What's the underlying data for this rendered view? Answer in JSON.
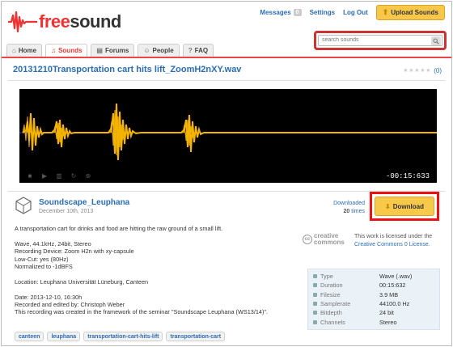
{
  "header": {
    "logo_text_free": "free",
    "logo_text_sound": "sound",
    "messages_label": "Messages",
    "messages_count": "0",
    "settings_label": "Settings",
    "logout_label": "Log Out",
    "upload_label": "Upload Sounds",
    "search_placeholder": "search sounds"
  },
  "nav": {
    "tabs": [
      {
        "label": "Home",
        "icon": "home-icon"
      },
      {
        "label": "Sounds",
        "icon": "headphones-icon",
        "active": true
      },
      {
        "label": "Forums",
        "icon": "chat-icon"
      },
      {
        "label": "People",
        "icon": "people-icon"
      },
      {
        "label": "FAQ",
        "icon": "help-icon"
      }
    ]
  },
  "sound": {
    "title": "20131210Transportation cart hits lift_ZoomH2nXY.wav",
    "rating_count": "(0)",
    "player_time": "-00:15:633",
    "username": "Soundscape_Leuphana",
    "date": "December 10th, 2013",
    "downloaded_label": "Downloaded",
    "downloaded_count": "20",
    "downloaded_suffix": "times",
    "download_label": "Download",
    "description": [
      "A transportation cart for drinks and food are hitting the raw ground of a small lift.",
      "Wave, 44.1kHz, 24bit, Stereo\nRecording Device: Zoom H2n with xy-capsule\nLow-Cut: yes (80Hz)\nNormalized to -1dBFS",
      "Location: Leuphana Universität Lüneburg, Canteen",
      "Date: 2013-12-10, 16:30h\nRecorded and edited by: Christoph Weber\nThis recording was created in the framework of the seminar \"Soundscape Leuphana (WS13/14)\"."
    ],
    "license_prefix": "This work is licensed under the ",
    "license_link": "Creative Commons 0 License",
    "license_suffix": ".",
    "cc_logo_line1": "creative",
    "cc_logo_line2": "commons",
    "meta": [
      {
        "key": "Type",
        "value": "Wave (.wav)"
      },
      {
        "key": "Duration",
        "value": "00:15:632"
      },
      {
        "key": "Filesize",
        "value": "3.9 MB"
      },
      {
        "key": "Samplerate",
        "value": "44100.0 Hz"
      },
      {
        "key": "Bitdepth",
        "value": "24 bit"
      },
      {
        "key": "Channels",
        "value": "Stereo"
      }
    ],
    "tags": [
      "canteen",
      "leuphana",
      "transportation-cart-hits-lift",
      "transportation-cart"
    ]
  },
  "colors": {
    "brand_red": "#e33333",
    "link_blue": "#2a6db5",
    "button_yellow": "#f8c84a",
    "waveform": "#f5b400"
  }
}
